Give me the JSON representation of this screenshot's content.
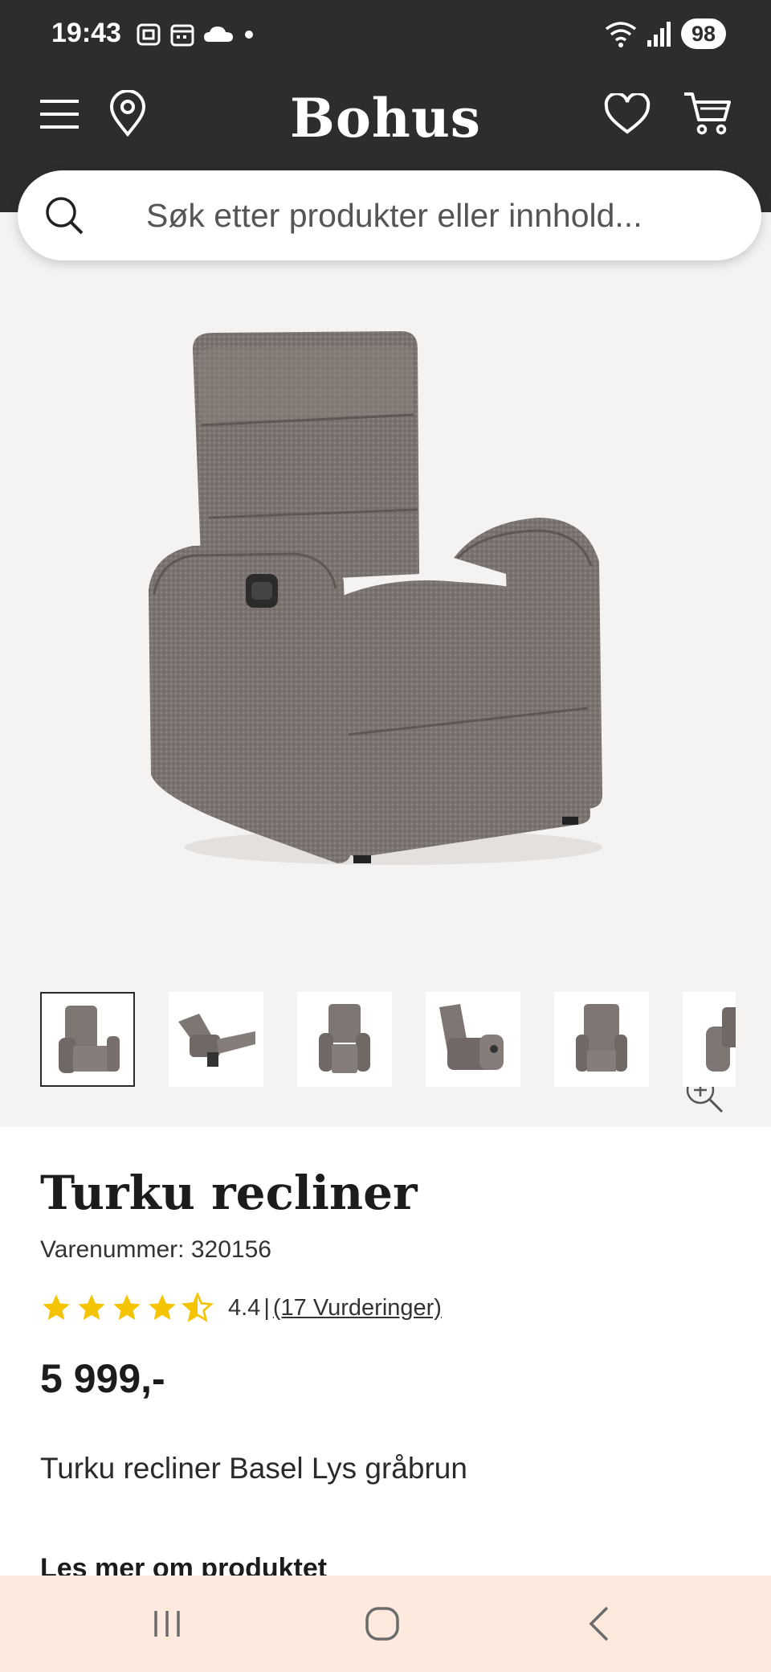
{
  "status_bar": {
    "time": "19:43",
    "battery": "98",
    "icons_left": [
      "screenshot-icon",
      "calendar-icon",
      "cloud-icon",
      "dot-icon"
    ],
    "icons_right": [
      "wifi-icon",
      "signal-icon"
    ]
  },
  "header": {
    "logo": "Bohus",
    "icons": [
      "menu-icon",
      "location-icon",
      "heart-icon",
      "cart-icon"
    ]
  },
  "search": {
    "placeholder": "Søk etter produkter eller innhold..."
  },
  "gallery": {
    "thumbnail_count": 6,
    "active_thumbnail": 1
  },
  "product": {
    "title": "Turku recliner",
    "sku": "Varenummer: 320156",
    "rating_value": "4.4",
    "rating_separator": "|",
    "rating_link": "(17 Vurderinger)",
    "rating_stars": 4.4,
    "price": "5 999,-",
    "description": "Turku recliner Basel Lys gråbrun",
    "read_more": "Les mer om produktet"
  },
  "colors": {
    "header_bg": "#2d2d30",
    "gallery_bg": "#f5f3f2",
    "star": "#f5c400",
    "navbar_bg": "#fde9dd"
  },
  "navbar": {
    "icons": [
      "recent-apps-icon",
      "home-icon",
      "back-icon"
    ]
  }
}
